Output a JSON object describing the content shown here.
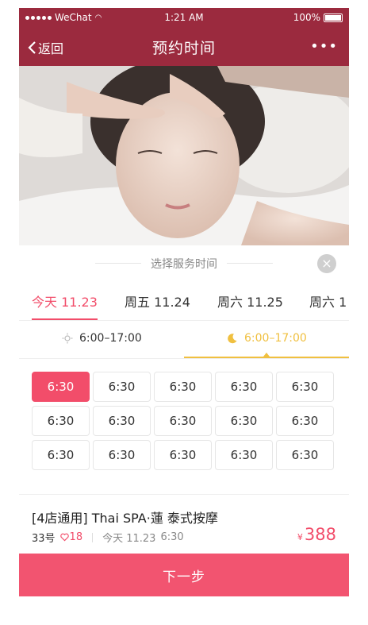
{
  "status_bar": {
    "carrier": "WeChat",
    "time": "1:21 AM",
    "battery": "100%"
  },
  "nav": {
    "back_label": "返回",
    "title": "预约时间",
    "more": "•••"
  },
  "sheet": {
    "title": "选择服务时间",
    "close": "×",
    "days": [
      {
        "label": "今天 11.23",
        "active": true
      },
      {
        "label": "周五 11.24",
        "active": false
      },
      {
        "label": "周六 11.25",
        "active": false
      },
      {
        "label": "周六 1",
        "active": false
      }
    ],
    "periods": [
      {
        "icon": "sun-icon",
        "label": "6:00–17:00",
        "active": false
      },
      {
        "icon": "moon-icon",
        "label": "6:00–17:00",
        "active": true
      }
    ],
    "slots": [
      "6:30",
      "6:30",
      "6:30",
      "6:30",
      "6:30",
      "6:30",
      "6:30",
      "6:30",
      "6:30",
      "6:30",
      "6:30",
      "6:30",
      "6:30",
      "6:30",
      "6:30"
    ],
    "selected_slot_index": 0
  },
  "summary": {
    "service_title": "[4店通用] Thai SPA·蓮 泰式按摩",
    "technician": "33号",
    "hearts": "18",
    "date": "今天 11.23",
    "time": "6:30",
    "currency": "¥",
    "price": "388"
  },
  "next_button": "下一步",
  "colors": {
    "nav_bg": "#9b2a3e",
    "accent": "#f24d6a",
    "period_active": "#f0c040"
  }
}
